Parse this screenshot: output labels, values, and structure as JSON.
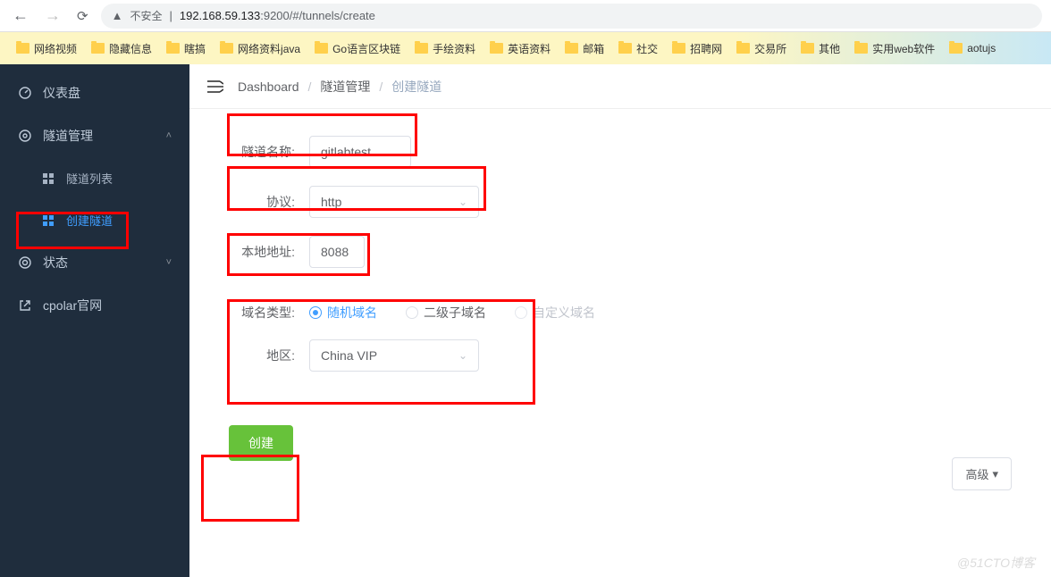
{
  "browser": {
    "insecure_label": "不安全",
    "url_host": "192.168.59.133",
    "url_port": ":9200",
    "url_path": "/#/tunnels/create"
  },
  "bookmarks": [
    "网络视频",
    "隐藏信息",
    "瞎搞",
    "网络资料java",
    "Go语言区块链",
    "手绘资料",
    "英语资料",
    "邮箱",
    "社交",
    "招聘网",
    "交易所",
    "其他",
    "实用web软件",
    "aotujs"
  ],
  "sidebar": {
    "dashboard": "仪表盘",
    "tunnel_mgmt": "隧道管理",
    "tunnel_list": "隧道列表",
    "create_tunnel": "创建隧道",
    "status": "状态",
    "cpolar": "cpolar官网"
  },
  "breadcrumb": {
    "dashboard": "Dashboard",
    "tunnel_mgmt": "隧道管理",
    "create_tunnel": "创建隧道"
  },
  "form": {
    "tunnel_name_label": "隧道名称:",
    "tunnel_name_value": "gitlabtest",
    "protocol_label": "协议:",
    "protocol_value": "http",
    "local_addr_label": "本地地址:",
    "local_addr_value": "8088",
    "domain_type_label": "域名类型:",
    "domain_random": "随机域名",
    "domain_sub": "二级子域名",
    "domain_custom": "自定义域名",
    "region_label": "地区:",
    "region_value": "China VIP",
    "advanced": "高级",
    "create": "创建"
  },
  "watermark": "@51CTO博客"
}
